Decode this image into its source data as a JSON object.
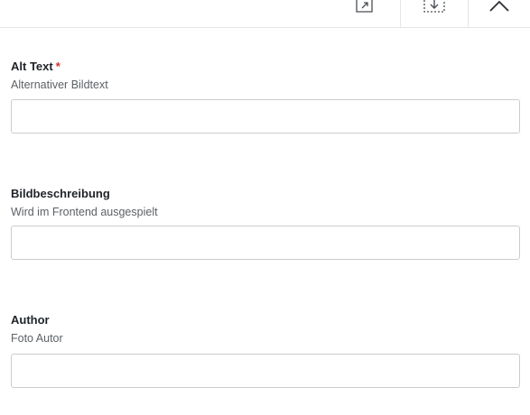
{
  "toolbar": {
    "open_icon": "open-external-icon",
    "save_icon": "save-download-icon",
    "close_icon": "chevron-up-icon"
  },
  "fields": [
    {
      "label": "Alt Text",
      "required_marker": "*",
      "help": "Alternativer Bildtext",
      "value": ""
    },
    {
      "label": "Bildbeschreibung",
      "help": "Wird im Frontend ausgespielt",
      "value": ""
    },
    {
      "label": "Author",
      "help": "Foto Autor",
      "value": ""
    }
  ],
  "colors": {
    "required": "#d0312d",
    "border": "#c8ccd1",
    "help_text": "#5c6166"
  }
}
